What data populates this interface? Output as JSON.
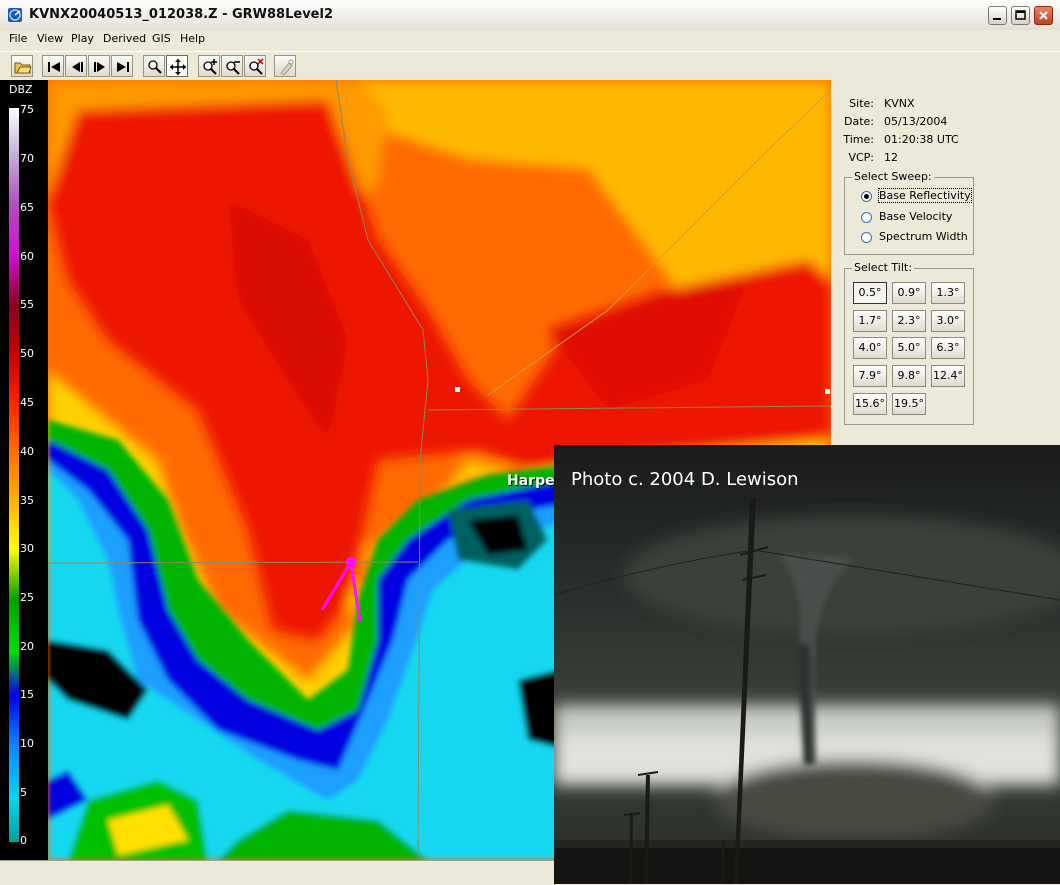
{
  "window": {
    "title": "KVNX20040513_012038.Z - GRW88Level2"
  },
  "menu": [
    "File",
    "View",
    "Play",
    "Derived",
    "GIS",
    "Help"
  ],
  "toolbar": {
    "icons": [
      "open-folder-icon",
      "skip-first-icon",
      "step-back-icon",
      "step-forward-icon",
      "skip-last-icon",
      "zoom-icon",
      "pan-icon",
      "zoom-in-icon",
      "zoom-out-icon",
      "zoom-reset-icon",
      "marker-icon"
    ],
    "active": "pan-icon"
  },
  "legend": {
    "title": "DBZ",
    "ticks": [
      "75",
      "70",
      "65",
      "60",
      "55",
      "50",
      "45",
      "40",
      "35",
      "30",
      "25",
      "20",
      "15",
      "10",
      "5",
      "0"
    ]
  },
  "map": {
    "place_label": "Harper"
  },
  "info": [
    {
      "key": "Site:",
      "value": "KVNX"
    },
    {
      "key": "Date:",
      "value": "05/13/2004"
    },
    {
      "key": "Time:",
      "value": "01:20:38 UTC"
    },
    {
      "key": "VCP:",
      "value": "12"
    }
  ],
  "sweep": {
    "title": "Select Sweep:",
    "options": [
      "Base Reflectivity",
      "Base Velocity",
      "Spectrum Width"
    ],
    "selected": "Base Reflectivity"
  },
  "tilt": {
    "title": "Select Tilt:",
    "options": [
      "0.5°",
      "0.9°",
      "1.3°",
      "1.7°",
      "2.3°",
      "3.0°",
      "4.0°",
      "5.0°",
      "6.3°",
      "7.9°",
      "9.8°",
      "12.4°",
      "15.6°",
      "19.5°"
    ],
    "selected": "0.5°"
  },
  "photo": {
    "credit": "Photo c. 2004 D. Lewison"
  },
  "colors": {
    "window_bg": "#ece9d8",
    "marker": "#ff00ff"
  }
}
